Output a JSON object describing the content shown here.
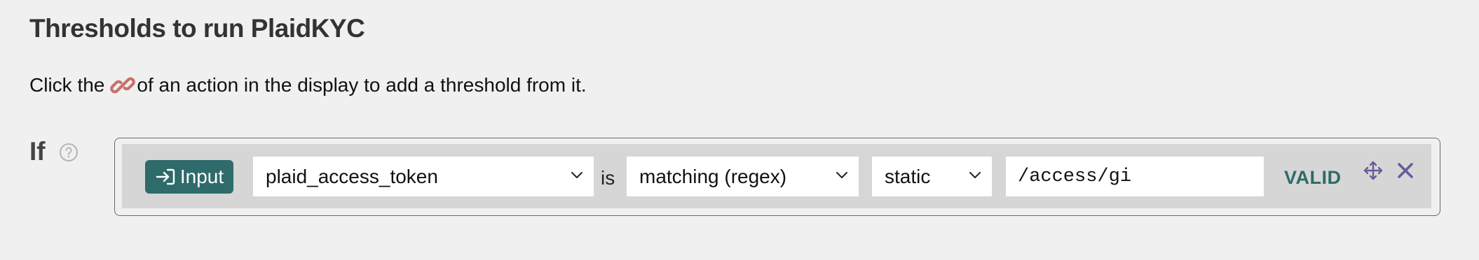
{
  "section": {
    "title": "Thresholds to run PlaidKYC",
    "instruction_before": "Click the",
    "instruction_after": "of an action in the display to add a threshold from it.",
    "link_icon": "link-icon"
  },
  "rule": {
    "if_label": "If",
    "help_icon": "help-circle-icon",
    "source_button": {
      "label": "Input",
      "icon": "sign-in-arrow-icon"
    },
    "field_select": {
      "value": "plaid_access_token"
    },
    "is_label": "is",
    "operator_select": {
      "value": "matching (regex)"
    },
    "value_type_select": {
      "value": "static"
    },
    "value_input": {
      "value": "/access/gi"
    },
    "status": "VALID",
    "move_icon": "move-arrows-icon",
    "remove_icon": "close-icon"
  },
  "colors": {
    "accent": "#2e6b6a",
    "icon_purple": "#6b5a9b",
    "link_icon": "#c9706a",
    "background": "#f0f0f0",
    "rule_background": "#d6d6d6"
  }
}
